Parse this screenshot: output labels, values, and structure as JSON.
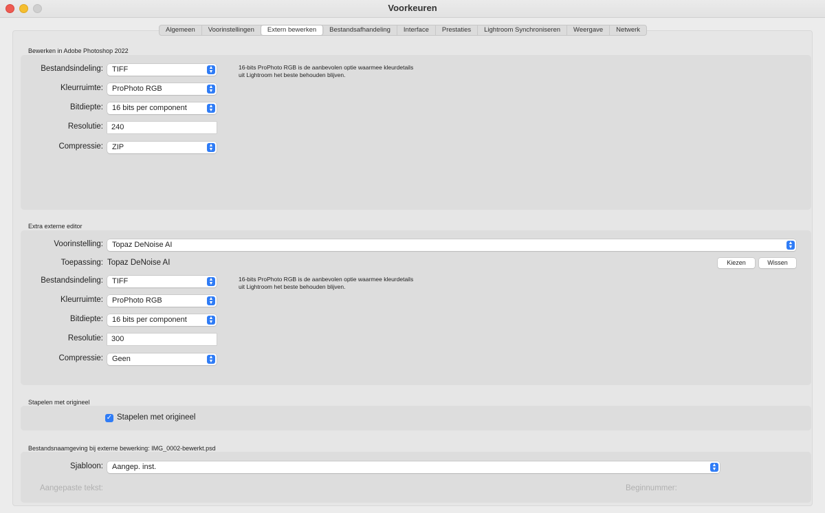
{
  "window": {
    "title": "Voorkeuren"
  },
  "tabs": [
    {
      "label": "Algemeen"
    },
    {
      "label": "Voorinstellingen"
    },
    {
      "label": "Extern bewerken"
    },
    {
      "label": "Bestandsafhandeling"
    },
    {
      "label": "Interface"
    },
    {
      "label": "Prestaties"
    },
    {
      "label": "Lightroom Synchroniseren"
    },
    {
      "label": "Weergave"
    },
    {
      "label": "Netwerk"
    }
  ],
  "photoshop": {
    "section_title": "Bewerken in Adobe Photoshop 2022",
    "format_label": "Bestandsindeling:",
    "format_value": "TIFF",
    "colorspace_label": "Kleurruimte:",
    "colorspace_value": "ProPhoto RGB",
    "bitdepth_label": "Bitdiepte:",
    "bitdepth_value": "16 bits per component",
    "resolution_label": "Resolutie:",
    "resolution_value": "240",
    "compression_label": "Compressie:",
    "compression_value": "ZIP",
    "note_line1": "16-bits ProPhoto RGB is de aanbevolen optie waarmee kleurdetails",
    "note_line2": "uit Lightroom het beste behouden blijven."
  },
  "external": {
    "section_title": "Extra externe editor",
    "preset_label": "Voorinstelling:",
    "preset_value": "Topaz DeNoise AI",
    "app_label": "Toepassing:",
    "app_value": "Topaz DeNoise AI",
    "choose_button": "Kiezen",
    "clear_button": "Wissen",
    "format_label": "Bestandsindeling:",
    "format_value": "TIFF",
    "colorspace_label": "Kleurruimte:",
    "colorspace_value": "ProPhoto RGB",
    "bitdepth_label": "Bitdiepte:",
    "bitdepth_value": "16 bits per component",
    "resolution_label": "Resolutie:",
    "resolution_value": "300",
    "compression_label": "Compressie:",
    "compression_value": "Geen",
    "note_line1": "16-bits ProPhoto RGB is de aanbevolen optie waarmee kleurdetails",
    "note_line2": "uit Lightroom het beste behouden blijven."
  },
  "stack": {
    "section_title": "Stapelen met origineel",
    "checkbox_label": "Stapelen met origineel",
    "checked": true
  },
  "naming": {
    "section_title": "Bestandsnaamgeving bij externe bewerking: IMG_0002-bewerkt.psd",
    "template_label": "Sjabloon:",
    "template_value": "Aangep. inst.",
    "custom_text_label": "Aangepaste tekst:",
    "start_number_label": "Beginnummer:"
  },
  "icons": {
    "popup_arrow": "chevron-up-down-icon",
    "checkmark": "checkmark-icon"
  },
  "colors": {
    "accent": "#2f7cf6",
    "close": "#ee5b52",
    "minimize": "#f5be2f",
    "zoom": "#cfcfcf"
  }
}
